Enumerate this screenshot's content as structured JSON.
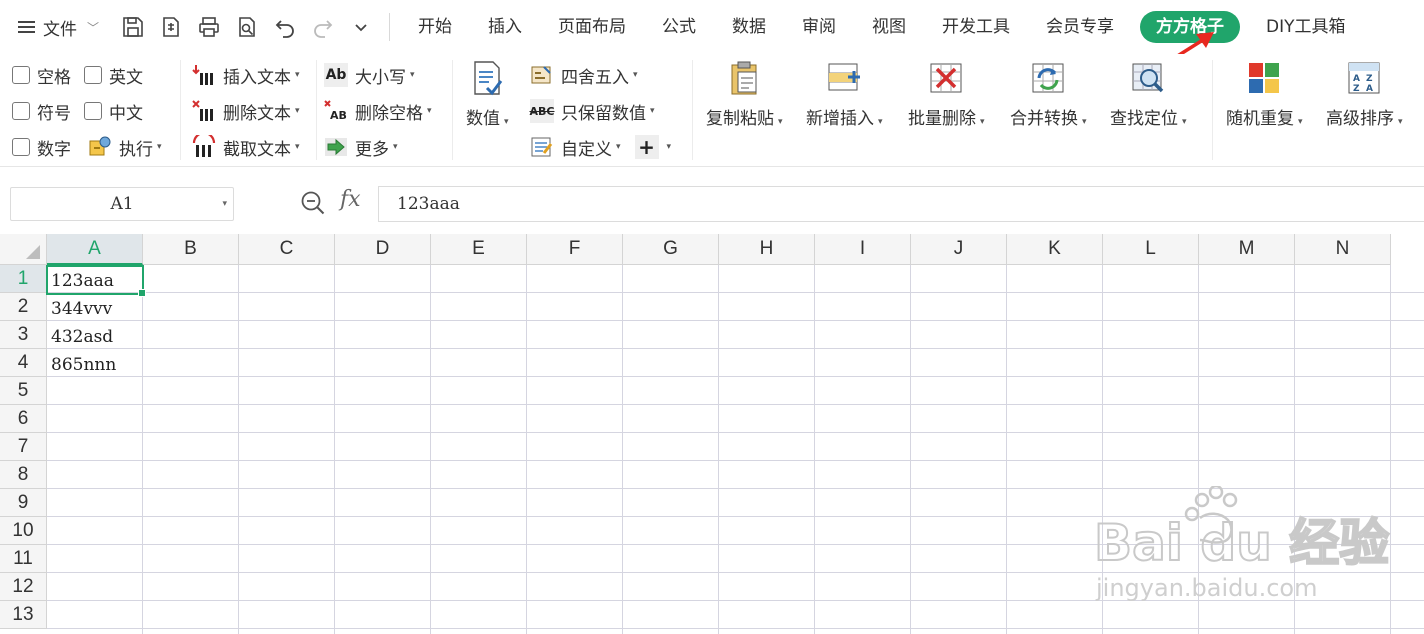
{
  "menubar": {
    "file_label": "文件",
    "tabs": [
      "开始",
      "插入",
      "页面布局",
      "公式",
      "数据",
      "审阅",
      "视图",
      "开发工具",
      "会员专享",
      "方方格子",
      "DIY工具箱"
    ],
    "active_tab": "方方格子",
    "accent_color": "#20a56b"
  },
  "ribbon": {
    "checkboxes": {
      "space": "空格",
      "english": "英文",
      "symbol": "符号",
      "chinese": "中文",
      "digit": "数字",
      "execute": "执行"
    },
    "text_group": {
      "insert_text": "插入文本",
      "delete_text": "删除文本",
      "extract_text": "截取文本"
    },
    "case_group": {
      "case": "大小写",
      "delete_space": "删除空格",
      "more": "更多"
    },
    "number_group": {
      "value": "数值",
      "round": "四舍五入",
      "keep_number": "只保留数值",
      "custom": "自定义"
    },
    "big_buttons": {
      "copy_paste": "复制粘贴",
      "add_insert": "新增插入",
      "batch_delete": "批量删除",
      "merge_convert": "合并转换",
      "find_locate": "查找定位",
      "random_repeat": "随机重复",
      "advanced_sort": "高级排序"
    }
  },
  "formula_bar": {
    "name_box": "A1",
    "fx_label": "fx",
    "content": "123aaa"
  },
  "sheet": {
    "columns": [
      "A",
      "B",
      "C",
      "D",
      "E",
      "F",
      "G",
      "H",
      "I",
      "J",
      "K",
      "L",
      "M",
      "N"
    ],
    "rows": [
      "1",
      "2",
      "3",
      "4",
      "5",
      "6",
      "7",
      "8",
      "9",
      "10",
      "11",
      "12",
      "13"
    ],
    "selected_column": "A",
    "selected_row": "1",
    "column_a_values": [
      "123aaa",
      "344vvv",
      "432asd",
      "865nnn"
    ]
  },
  "watermark": {
    "brand": "Bai du 经验",
    "url": "jingyan.baidu.com"
  }
}
